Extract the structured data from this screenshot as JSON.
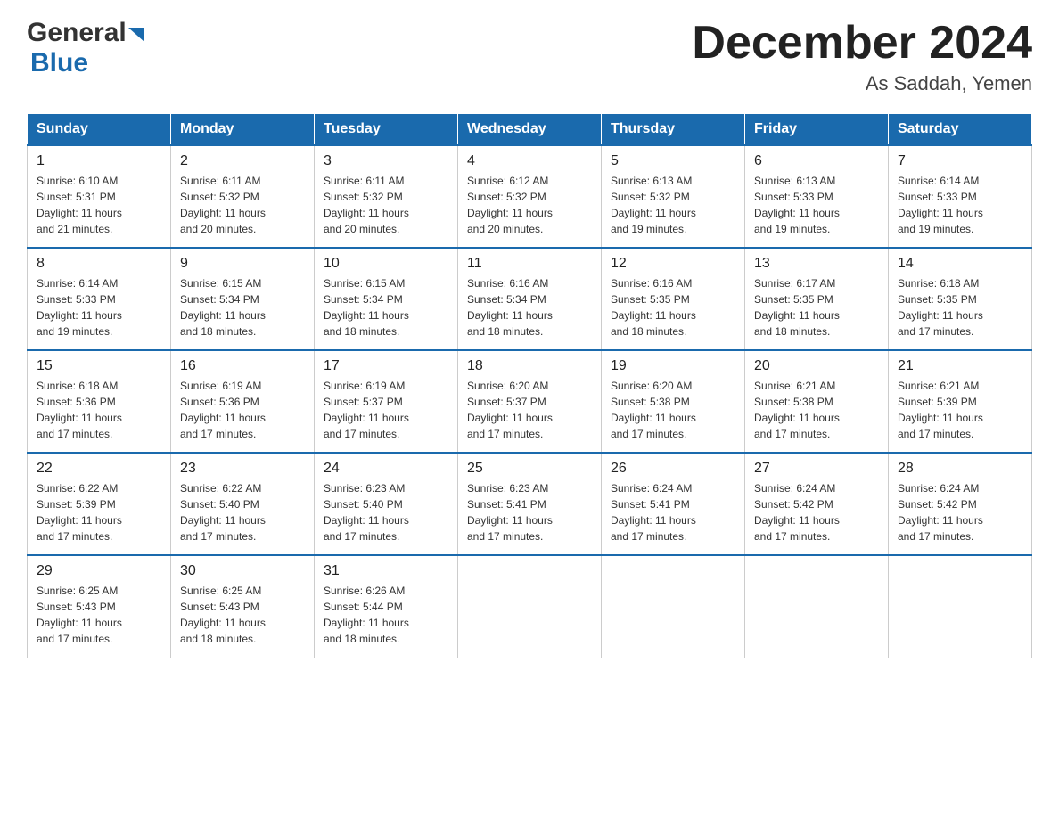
{
  "header": {
    "logo_general": "General",
    "logo_blue": "Blue",
    "title": "December 2024",
    "subtitle": "As Saddah, Yemen"
  },
  "days_of_week": [
    "Sunday",
    "Monday",
    "Tuesday",
    "Wednesday",
    "Thursday",
    "Friday",
    "Saturday"
  ],
  "weeks": [
    [
      {
        "day": "1",
        "sunrise": "6:10 AM",
        "sunset": "5:31 PM",
        "daylight": "11 hours and 21 minutes."
      },
      {
        "day": "2",
        "sunrise": "6:11 AM",
        "sunset": "5:32 PM",
        "daylight": "11 hours and 20 minutes."
      },
      {
        "day": "3",
        "sunrise": "6:11 AM",
        "sunset": "5:32 PM",
        "daylight": "11 hours and 20 minutes."
      },
      {
        "day": "4",
        "sunrise": "6:12 AM",
        "sunset": "5:32 PM",
        "daylight": "11 hours and 20 minutes."
      },
      {
        "day": "5",
        "sunrise": "6:13 AM",
        "sunset": "5:32 PM",
        "daylight": "11 hours and 19 minutes."
      },
      {
        "day": "6",
        "sunrise": "6:13 AM",
        "sunset": "5:33 PM",
        "daylight": "11 hours and 19 minutes."
      },
      {
        "day": "7",
        "sunrise": "6:14 AM",
        "sunset": "5:33 PM",
        "daylight": "11 hours and 19 minutes."
      }
    ],
    [
      {
        "day": "8",
        "sunrise": "6:14 AM",
        "sunset": "5:33 PM",
        "daylight": "11 hours and 19 minutes."
      },
      {
        "day": "9",
        "sunrise": "6:15 AM",
        "sunset": "5:34 PM",
        "daylight": "11 hours and 18 minutes."
      },
      {
        "day": "10",
        "sunrise": "6:15 AM",
        "sunset": "5:34 PM",
        "daylight": "11 hours and 18 minutes."
      },
      {
        "day": "11",
        "sunrise": "6:16 AM",
        "sunset": "5:34 PM",
        "daylight": "11 hours and 18 minutes."
      },
      {
        "day": "12",
        "sunrise": "6:16 AM",
        "sunset": "5:35 PM",
        "daylight": "11 hours and 18 minutes."
      },
      {
        "day": "13",
        "sunrise": "6:17 AM",
        "sunset": "5:35 PM",
        "daylight": "11 hours and 18 minutes."
      },
      {
        "day": "14",
        "sunrise": "6:18 AM",
        "sunset": "5:35 PM",
        "daylight": "11 hours and 17 minutes."
      }
    ],
    [
      {
        "day": "15",
        "sunrise": "6:18 AM",
        "sunset": "5:36 PM",
        "daylight": "11 hours and 17 minutes."
      },
      {
        "day": "16",
        "sunrise": "6:19 AM",
        "sunset": "5:36 PM",
        "daylight": "11 hours and 17 minutes."
      },
      {
        "day": "17",
        "sunrise": "6:19 AM",
        "sunset": "5:37 PM",
        "daylight": "11 hours and 17 minutes."
      },
      {
        "day": "18",
        "sunrise": "6:20 AM",
        "sunset": "5:37 PM",
        "daylight": "11 hours and 17 minutes."
      },
      {
        "day": "19",
        "sunrise": "6:20 AM",
        "sunset": "5:38 PM",
        "daylight": "11 hours and 17 minutes."
      },
      {
        "day": "20",
        "sunrise": "6:21 AM",
        "sunset": "5:38 PM",
        "daylight": "11 hours and 17 minutes."
      },
      {
        "day": "21",
        "sunrise": "6:21 AM",
        "sunset": "5:39 PM",
        "daylight": "11 hours and 17 minutes."
      }
    ],
    [
      {
        "day": "22",
        "sunrise": "6:22 AM",
        "sunset": "5:39 PM",
        "daylight": "11 hours and 17 minutes."
      },
      {
        "day": "23",
        "sunrise": "6:22 AM",
        "sunset": "5:40 PM",
        "daylight": "11 hours and 17 minutes."
      },
      {
        "day": "24",
        "sunrise": "6:23 AM",
        "sunset": "5:40 PM",
        "daylight": "11 hours and 17 minutes."
      },
      {
        "day": "25",
        "sunrise": "6:23 AM",
        "sunset": "5:41 PM",
        "daylight": "11 hours and 17 minutes."
      },
      {
        "day": "26",
        "sunrise": "6:24 AM",
        "sunset": "5:41 PM",
        "daylight": "11 hours and 17 minutes."
      },
      {
        "day": "27",
        "sunrise": "6:24 AM",
        "sunset": "5:42 PM",
        "daylight": "11 hours and 17 minutes."
      },
      {
        "day": "28",
        "sunrise": "6:24 AM",
        "sunset": "5:42 PM",
        "daylight": "11 hours and 17 minutes."
      }
    ],
    [
      {
        "day": "29",
        "sunrise": "6:25 AM",
        "sunset": "5:43 PM",
        "daylight": "11 hours and 17 minutes."
      },
      {
        "day": "30",
        "sunrise": "6:25 AM",
        "sunset": "5:43 PM",
        "daylight": "11 hours and 18 minutes."
      },
      {
        "day": "31",
        "sunrise": "6:26 AM",
        "sunset": "5:44 PM",
        "daylight": "11 hours and 18 minutes."
      },
      null,
      null,
      null,
      null
    ]
  ],
  "labels": {
    "sunrise": "Sunrise:",
    "sunset": "Sunset:",
    "daylight": "Daylight:"
  }
}
